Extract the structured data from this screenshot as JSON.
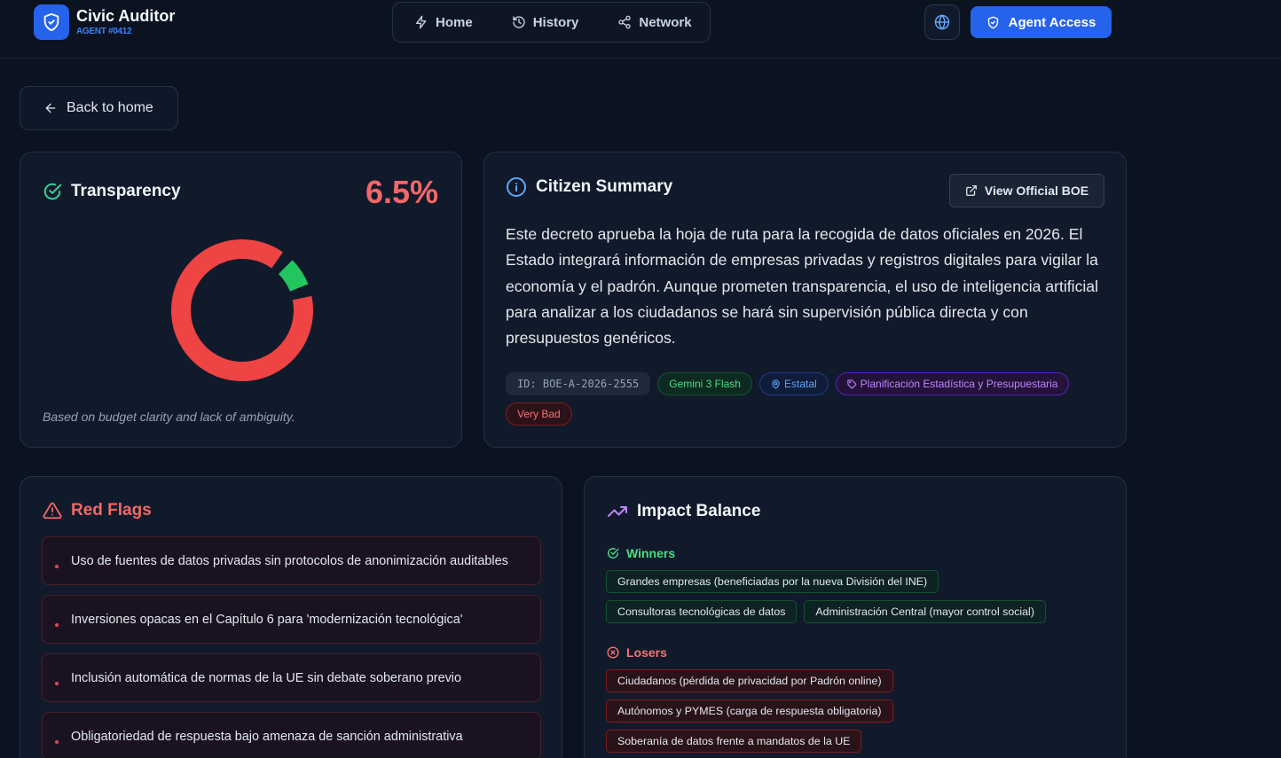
{
  "brand": {
    "title": "Civic Auditor",
    "subtitle": "AGENT #0412"
  },
  "nav": {
    "home": "Home",
    "history": "History",
    "network": "Network"
  },
  "header": {
    "agent_access": "Agent Access"
  },
  "back_label": "Back to home",
  "transparency": {
    "title": "Transparency",
    "score_text": "6.5%",
    "score_value": 6.5,
    "note": "Based on budget clarity and lack of ambiguity.",
    "colors": {
      "filled": "#22c55e",
      "remaining": "#ef4444",
      "score": "#f26767"
    }
  },
  "summary": {
    "title": "Citizen Summary",
    "boe_button": "View Official BOE",
    "text": "Este decreto aprueba la hoja de ruta para la recogida de datos oficiales en 2026. El Estado integrará información de empresas privadas y registros digitales para vigilar la economía y el padrón. Aunque prometen transparencia, el uso de inteligencia artificial para analizar a los ciudadanos se hará sin supervisión pública directa y con presupuestos genéricos.",
    "tags": {
      "id": "ID: BOE-A-2026-2555",
      "model": "Gemini 3 Flash",
      "scope": "Estatal",
      "category": "Planificación Estadística y Presupuestaria",
      "rating": "Very Bad"
    }
  },
  "red_flags": {
    "title": "Red Flags",
    "items": [
      "Uso de fuentes de datos privadas sin protocolos de anonimización auditables",
      "Inversiones opacas en el Capítulo 6 para 'modernización tecnológica'",
      "Inclusión automática de normas de la UE sin debate soberano previo",
      "Obligatoriedad de respuesta bajo amenaza de sanción administrativa"
    ]
  },
  "impact": {
    "title": "Impact Balance",
    "winners_title": "Winners",
    "winners": [
      "Grandes empresas (beneficiadas por la nueva División del INE)",
      "Consultoras tecnológicas de datos",
      "Administración Central (mayor control social)"
    ],
    "losers_title": "Losers",
    "losers": [
      "Ciudadanos (pérdida de privacidad por Padrón online)",
      "Autónomos y PYMES (carga de respuesta obligatoria)",
      "Soberanía de datos frente a mandatos de la UE"
    ]
  }
}
